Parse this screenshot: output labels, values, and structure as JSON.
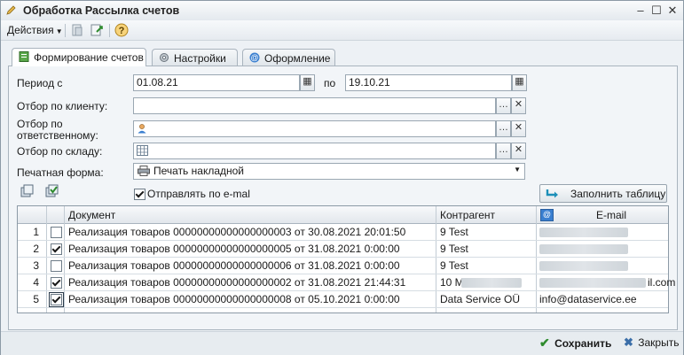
{
  "window": {
    "title": "Обработка  Рассылка счетов"
  },
  "toolbar": {
    "actions_label": "Действия"
  },
  "tabs": [
    {
      "label": "Формирование счетов"
    },
    {
      "label": "Настройки"
    },
    {
      "label": "Оформление"
    }
  ],
  "form": {
    "period_label": "Период с",
    "period_from": "01.08.21",
    "period_to_label": "по",
    "period_to": "19.10.21",
    "client_label": "Отбор по клиенту:",
    "responsible_label": "Отбор по ответственному:",
    "warehouse_label": "Отбор по складу:",
    "print_form_label": "Печатная форма:",
    "print_form_value": "Печать накладной",
    "send_email_label": "Отправлять по e-mal",
    "fill_table_label": "Заполнить таблицу"
  },
  "table": {
    "columns": [
      "Документ",
      "Контрагент",
      "E-mail"
    ],
    "rows": [
      {
        "n": "1",
        "checked": false,
        "document": "Реализация товаров 00000000000000000003 от 30.08.2021 20:01:50",
        "counterparty": "9 Test",
        "email": ""
      },
      {
        "n": "2",
        "checked": true,
        "document": "Реализация товаров 00000000000000000005 от 31.08.2021 0:00:00",
        "counterparty": "9 Test",
        "email": ""
      },
      {
        "n": "3",
        "checked": false,
        "document": "Реализация товаров 00000000000000000006 от 31.08.2021 0:00:00",
        "counterparty": "9 Test",
        "email": ""
      },
      {
        "n": "4",
        "checked": true,
        "document": "Реализация товаров 00000000000000000002 от 31.08.2021 21:44:31",
        "counterparty": "10 M",
        "email": "il.com"
      },
      {
        "n": "5",
        "checked": true,
        "document": "Реализация товаров 00000000000000000008 от 05.10.2021 0:00:00",
        "counterparty": "Data Service OÜ",
        "email": "info@dataservice.ee"
      }
    ]
  },
  "footer": {
    "save_label": "Сохранить",
    "close_label": "Закрыть"
  },
  "colors": {
    "accent": "#2f6fb3",
    "save_green": "#2e8b2e",
    "close_blue": "#3a6ea8"
  }
}
